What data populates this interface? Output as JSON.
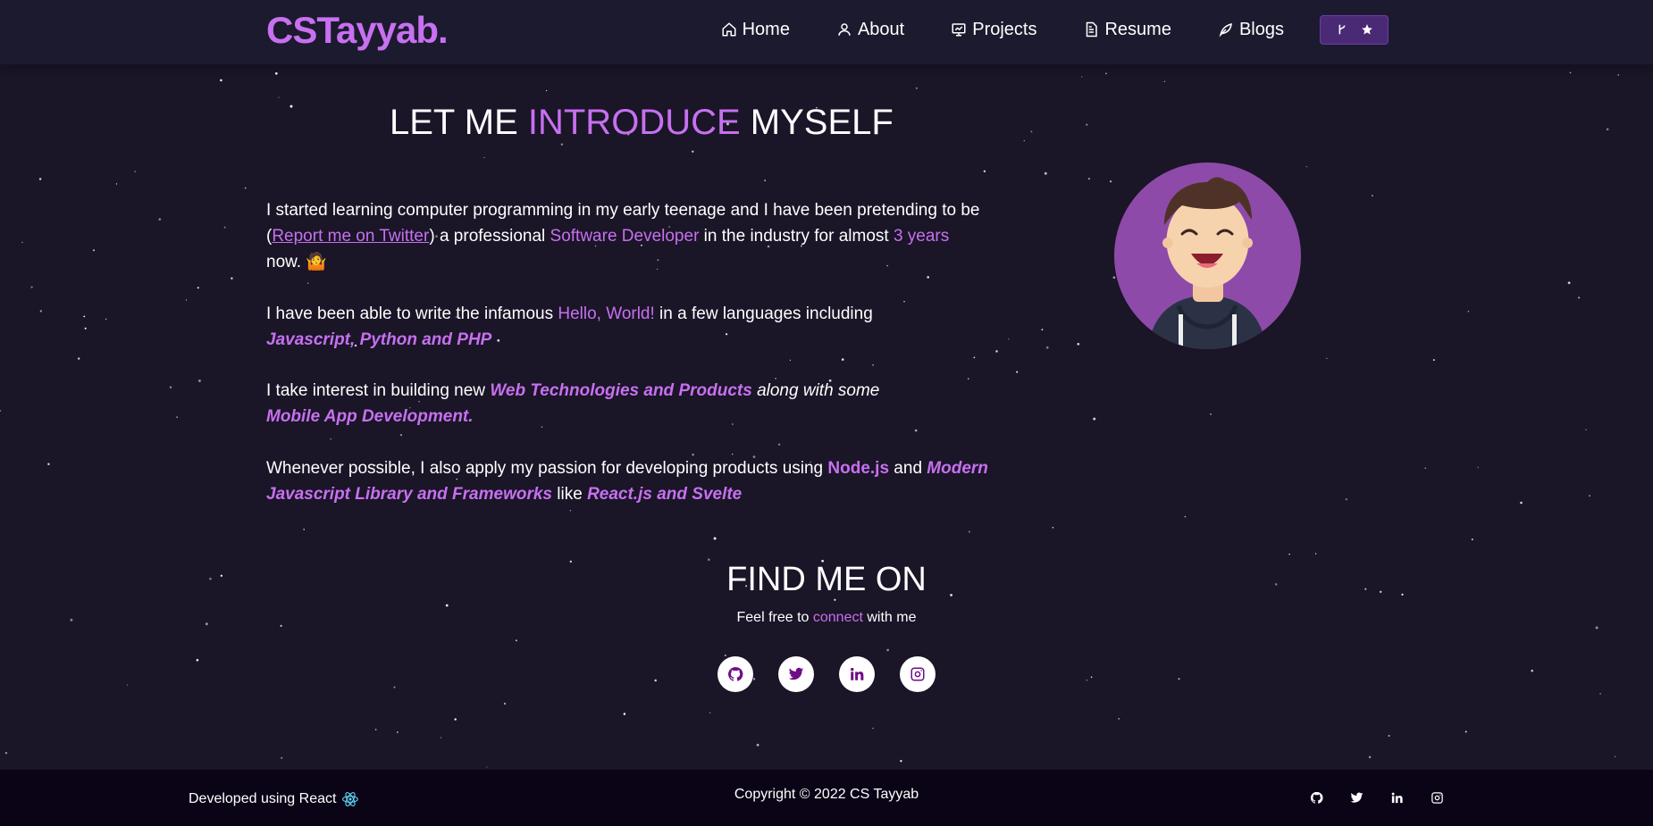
{
  "brand": "CSTayyab.",
  "nav": {
    "home": "Home",
    "about": "About",
    "projects": "Projects",
    "resume": "Resume",
    "blogs": "Blogs"
  },
  "about": {
    "heading_pre": "LET ME",
    "heading_highlight": "INTRODUCE",
    "heading_post": "MYSELF",
    "p1_a": "I started learning computer programming in my early teenage and I have been pretending to be (",
    "p1_link": "Report me on Twitter",
    "p1_b": ") a professional ",
    "p1_role": "Software Developer",
    "p1_c": " in the industry for almost ",
    "p1_years": "3 years",
    "p1_d": " now. 🤷",
    "p2_a": "I have been able to write the infamous ",
    "p2_hello": "Hello, World!",
    "p2_b": " in a few languages including",
    "p2_langs": "Javascript, Python and PHP",
    "p3_a": "I take interest in building new  ",
    "p3_web": "Web Technologies and Products",
    "p3_b": " along with some",
    "p3_mobile": "Mobile App Development.",
    "p4_a": "Whenever possible, I also apply my passion for developing products using ",
    "p4_node": "Node.js",
    "p4_b": " and ",
    "p4_modern": "Modern Javascript Library and Frameworks",
    "p4_c": "  like ",
    "p4_react": "React.js and Svelte"
  },
  "find": {
    "title": "FIND ME ON",
    "sub_a": "Feel free to ",
    "sub_link": "connect",
    "sub_b": " with me"
  },
  "footer": {
    "left": "Developed using React",
    "center": "Copyright © 2022 CS Tayyab"
  },
  "colors": {
    "accent": "#c770f0",
    "background": "#1a1527",
    "footer": "#0a0416",
    "social_icon": "#700c86"
  },
  "icons": [
    "home-icon",
    "user-icon",
    "projects-icon",
    "resume-icon",
    "blogs-icon",
    "fork-icon",
    "star-icon",
    "github-icon",
    "twitter-icon",
    "linkedin-icon",
    "instagram-icon",
    "react-icon"
  ]
}
